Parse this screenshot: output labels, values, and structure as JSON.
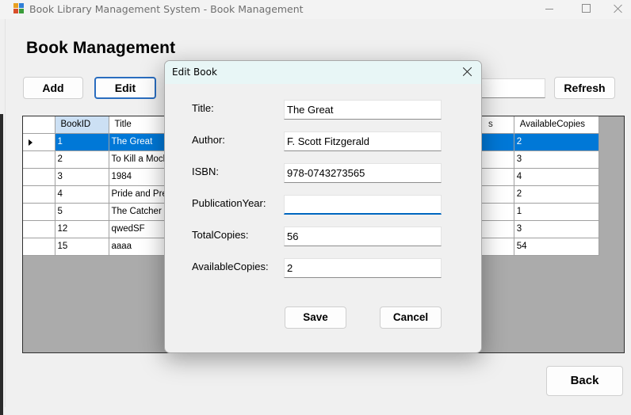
{
  "window": {
    "title": "Book Library Management System - Book Management",
    "icon": "library-app-icon",
    "icon_colors": [
      "#e8a020",
      "#2f7fd8",
      "#d94f2b",
      "#3a9c3a"
    ]
  },
  "page": {
    "title": "Book Management"
  },
  "toolbar": {
    "add_label": "Add",
    "edit_label": "Edit",
    "search_value": "",
    "refresh_label": "Refresh"
  },
  "grid": {
    "columns": [
      "BookID",
      "Title",
      "AvailableCopies"
    ],
    "selected_row": 0,
    "rows": [
      {
        "id": "1",
        "title": "The Great",
        "available": "2"
      },
      {
        "id": "2",
        "title": "To Kill a Mock",
        "available": "3"
      },
      {
        "id": "3",
        "title": "1984",
        "available": "4"
      },
      {
        "id": "4",
        "title": "Pride and Preju",
        "available": "2"
      },
      {
        "id": "5",
        "title": "The Catcher in",
        "available": "1"
      },
      {
        "id": "12",
        "title": "qwedSF",
        "available": "3"
      },
      {
        "id": "15",
        "title": "aaaa",
        "available": "54"
      }
    ],
    "hidden_header_fragment": "s",
    "selection_color": "#0078d7"
  },
  "footer": {
    "back_label": "Back"
  },
  "dialog": {
    "title": "Edit Book",
    "fields": {
      "title_label": "Title:",
      "title_value": "The Great",
      "author_label": "Author:",
      "author_value": "F. Scott Fitzgerald",
      "isbn_label": "ISBN:",
      "isbn_value": "978-0743273565",
      "year_label": "PublicationYear:",
      "year_value": "",
      "total_label": "TotalCopies:",
      "total_value": "56",
      "available_label": "AvailableCopies:",
      "available_value": "2"
    },
    "save_label": "Save",
    "cancel_label": "Cancel",
    "focus_color": "#0067c0"
  }
}
